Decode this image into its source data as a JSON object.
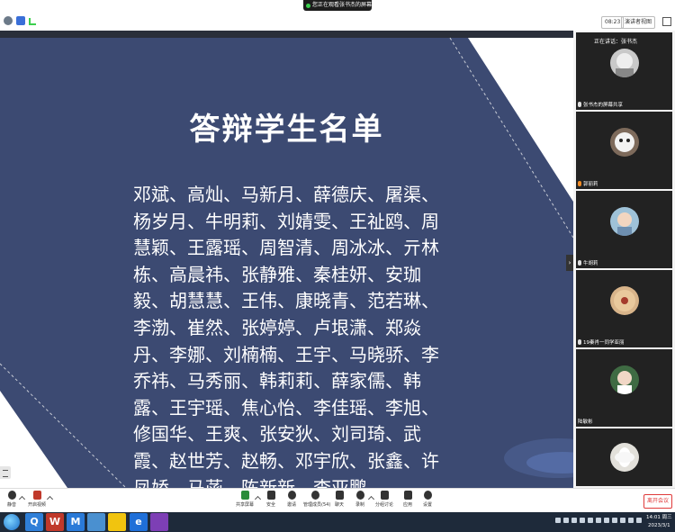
{
  "top_notice": {
    "text": "您正在观看张书杰的屏幕"
  },
  "meeting_bar": {
    "time": "08:23",
    "view_label": "演讲者视图"
  },
  "slide": {
    "title": "答辩学生名单",
    "names": "邓斌、高灿、马新月、薛德庆、屠渠、杨岁月、牛明莉、刘婧雯、王祉鸥、周慧颖、王露瑶、周智清、周冰冰、亓林栋、高晨祎、张静雅、秦桂妍、安珈毅、胡慧慧、王伟、康晓青、范若琳、李渤、崔然、张婷婷、卢垠潇、郑焱丹、李娜、刘楠楠、王宇、马晓骄、李乔祎、马秀丽、韩莉莉、薛家儒、韩露、王宇瑶、焦心怡、李佳瑶、李旭、修国华、王爽、张安狄、刘司琦、武霞、赵世芳、赵畅、邓宇欣、张鑫、许凤娇、马菡、陈新新、李亚鹏"
  },
  "participants": [
    {
      "top_label": "正在讲话：张书杰",
      "name": "张书杰的屏幕共享",
      "avatar_color": "#c9c9c9"
    },
    {
      "top_label": "",
      "name": "郭丽莉",
      "avatar_color": "#7d6a5b"
    },
    {
      "top_label": "",
      "name": "牛胡莉",
      "avatar_color": "#9fc2d8"
    },
    {
      "top_label": "",
      "name": "19秦肖一同学亚丽",
      "avatar_color": "#d8b48a"
    },
    {
      "top_label": "",
      "name": "陆敏彬",
      "avatar_color": "#3f6b43"
    },
    {
      "top_label": "",
      "name": "",
      "avatar_color": "#e2e0da"
    }
  ],
  "toolbar": {
    "mute": "静音",
    "video": "开启视频",
    "share": "共享屏幕",
    "security": "安全",
    "invite": "邀请",
    "manage": "管理成员(54)",
    "chat": "聊天",
    "record": "录制",
    "breakout": "分组讨论",
    "apps": "应用",
    "settings": "设置",
    "leave": "离开会议"
  },
  "taskbar": {
    "clock_time": "14:01 周三",
    "clock_date": "2023/3/1",
    "apps": [
      "Q",
      "W",
      "M",
      "",
      "e",
      ""
    ]
  }
}
